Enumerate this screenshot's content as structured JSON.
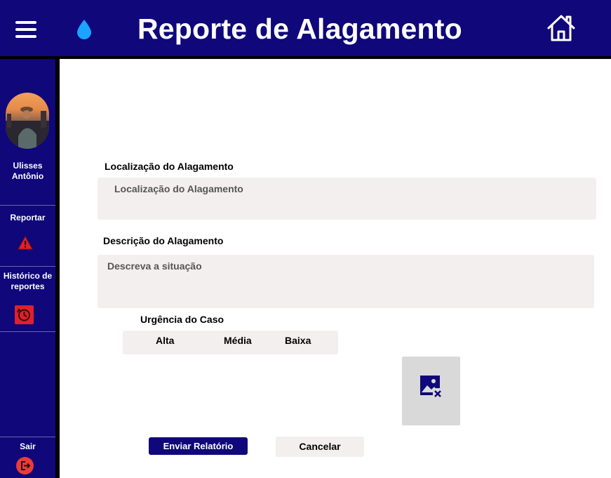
{
  "header": {
    "title": "Reporte de Alagamento",
    "menu_icon": "hamburger-menu-icon",
    "logo_icon": "water-drop-icon",
    "home_icon": "home-icon"
  },
  "sidebar": {
    "user_name": "Ulisses Antônio",
    "items": [
      {
        "label": "Reportar",
        "icon": "warning-icon"
      },
      {
        "label": "Histórico de reportes",
        "icon": "history-icon"
      },
      {
        "label": "Sair",
        "icon": "logout-icon"
      }
    ]
  },
  "form": {
    "location_label": "Localização do Alagamento",
    "location_placeholder": "Localização do Alagamento",
    "description_label": "Descrição do Alagamento",
    "description_placeholder": "Descreva a situação",
    "urgency_label": "Urgência do Caso",
    "urgency_options": [
      "Alta",
      "Média",
      "Baixa"
    ],
    "image_icon": "broken-image-icon",
    "submit_label": "Enviar Relatório",
    "cancel_label": "Cancelar"
  },
  "colors": {
    "primary": "#0f077a",
    "field_bg": "#f4efef",
    "warning": "#e0202a",
    "logout": "#ea3b3b",
    "drop": "#1aa3ff"
  }
}
